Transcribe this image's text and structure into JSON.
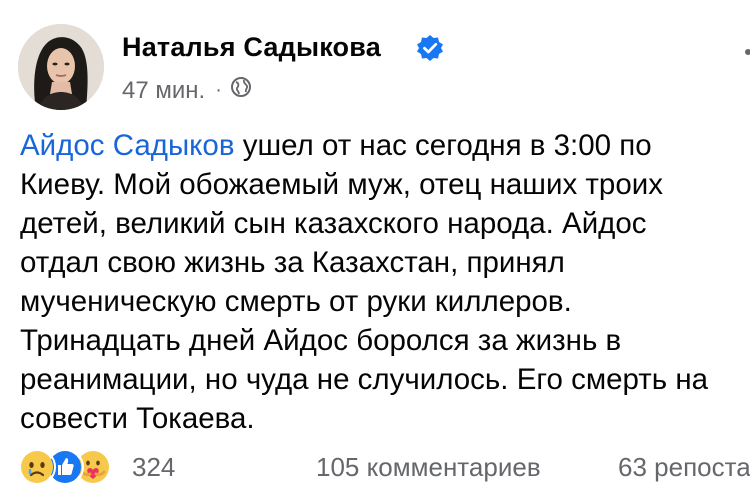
{
  "post": {
    "author": "Наталья Садыкова",
    "time": "47 мин.",
    "separator": "·",
    "mention": "Айдос Садыков",
    "lines": [
      " ушел от нас сегодня в 3:00 по",
      "Киеву. Мой обожаемый муж, отец наших троих",
      "детей, великий сын казахского народа. Айдос",
      "отдал свою жизнь за Казахстан, принял",
      "мученическую смерть от руки киллеров.",
      "Тринадцать дней Айдос боролся за жизнь в",
      "реанимации, но чуда не случилось. Его смерть на",
      "совести Токаева."
    ]
  },
  "reactions": {
    "icons": [
      "sad-icon",
      "like-icon",
      "care-icon"
    ],
    "count": "324",
    "comments": "105 комментариев",
    "shares": "63 репоста"
  },
  "colors": {
    "mention": "#1866d8",
    "verified": "#1877f2",
    "secondary_text": "#65676b"
  }
}
